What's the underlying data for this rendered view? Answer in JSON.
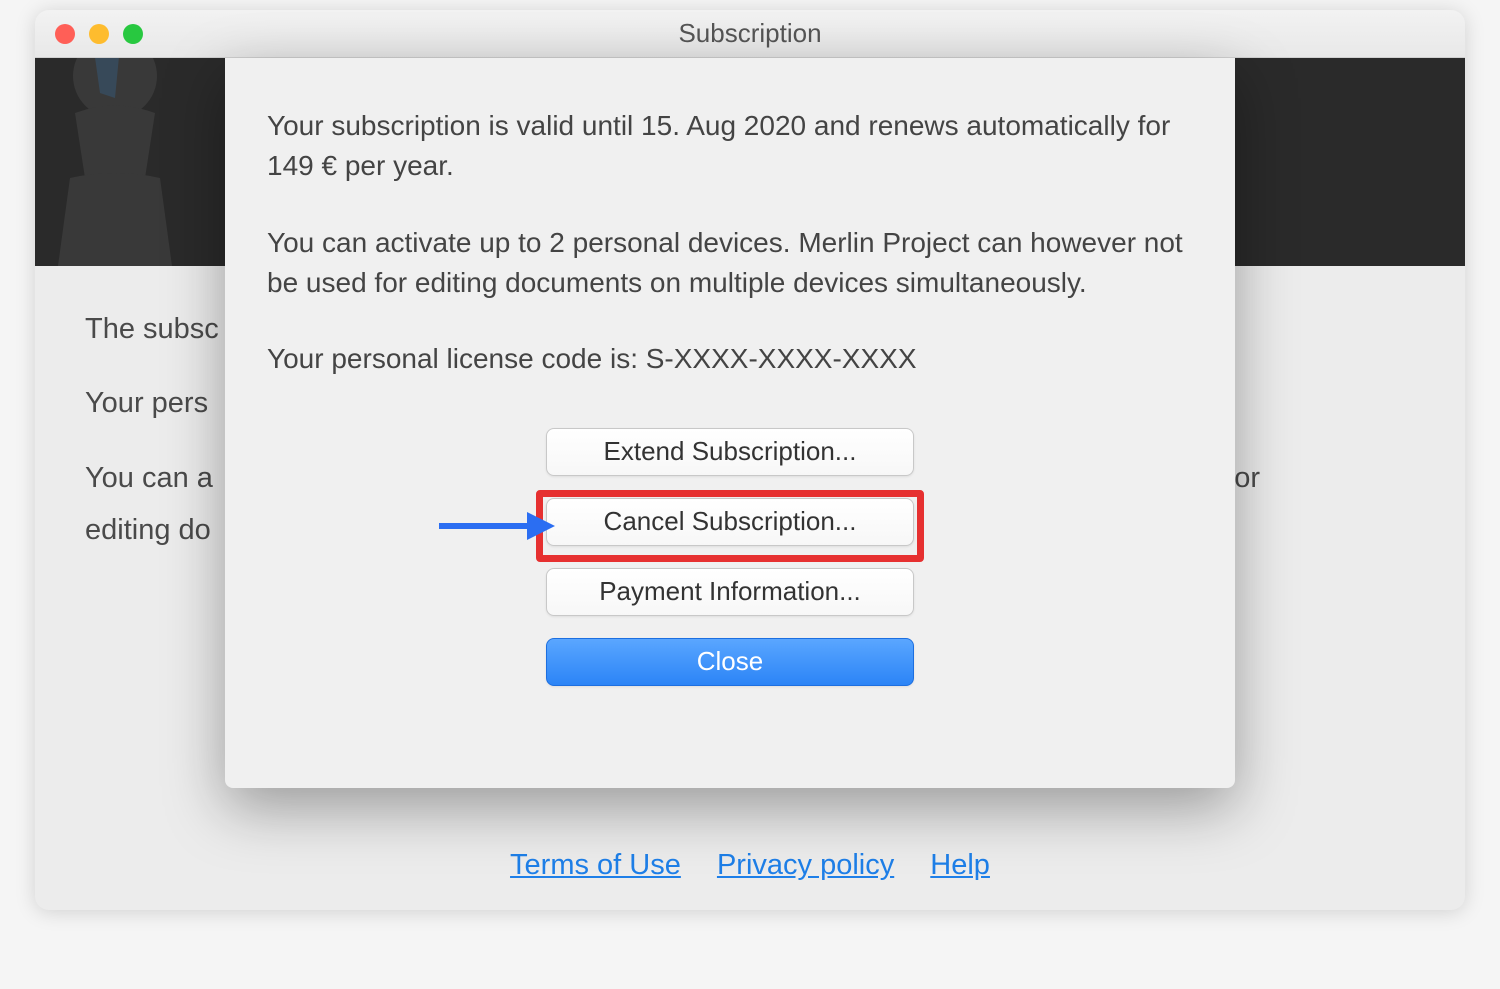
{
  "window": {
    "title": "Subscription"
  },
  "background": {
    "line1": "The subsc",
    "line2": "Your pers",
    "line3_prefix": "You can a",
    "line3_suffix": "for",
    "line4": "editing do"
  },
  "sheet": {
    "p1": "Your subscription is valid until 15. Aug 2020 and renews automatically for 149 € per year.",
    "p2": "You can activate up to 2 personal devices. Merlin Project can however not be used for editing documents on multiple devices simultaneously.",
    "p3": "Your personal license code is: S-XXXX-XXXX-XXXX"
  },
  "buttons": {
    "extend": "Extend Subscription...",
    "cancel": "Cancel Subscription...",
    "payment": "Payment Information...",
    "close": "Close"
  },
  "footer": {
    "terms": "Terms of Use",
    "privacy": "Privacy policy",
    "help": "Help"
  }
}
